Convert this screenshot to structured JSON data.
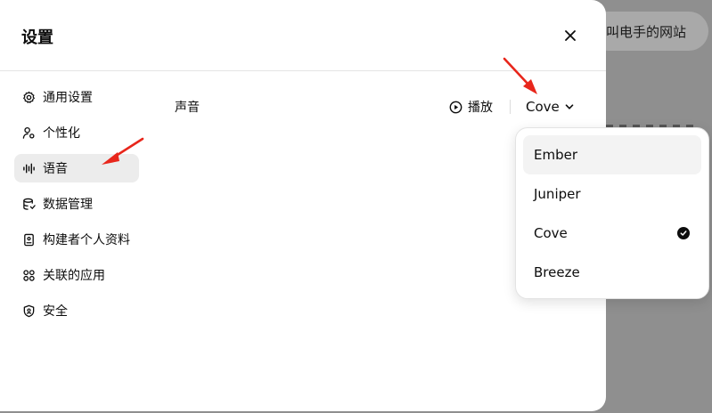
{
  "background": {
    "chip_text": "叫电手的网站"
  },
  "modal": {
    "title": "设置",
    "close_icon": "close-icon"
  },
  "sidebar": {
    "items": [
      {
        "label": "通用设置",
        "icon": "gear-icon",
        "active": false
      },
      {
        "label": "个性化",
        "icon": "person-sliders-icon",
        "active": false
      },
      {
        "label": "语音",
        "icon": "waveform-icon",
        "active": true
      },
      {
        "label": "数据管理",
        "icon": "database-icon",
        "active": false
      },
      {
        "label": "构建者个人资料",
        "icon": "id-card-icon",
        "active": false
      },
      {
        "label": "关联的应用",
        "icon": "apps-grid-icon",
        "active": false
      },
      {
        "label": "安全",
        "icon": "shield-icon",
        "active": false
      }
    ]
  },
  "voice": {
    "label": "声音",
    "play_label": "播放",
    "selected": "Cove",
    "options": [
      {
        "label": "Ember",
        "selected": false
      },
      {
        "label": "Juniper",
        "selected": false
      },
      {
        "label": "Cove",
        "selected": true
      },
      {
        "label": "Breeze",
        "selected": false
      }
    ]
  },
  "colors": {
    "overlay": "#8f8f8f",
    "active_item_bg": "#ececec",
    "annotation_arrow": "#e8261b"
  }
}
